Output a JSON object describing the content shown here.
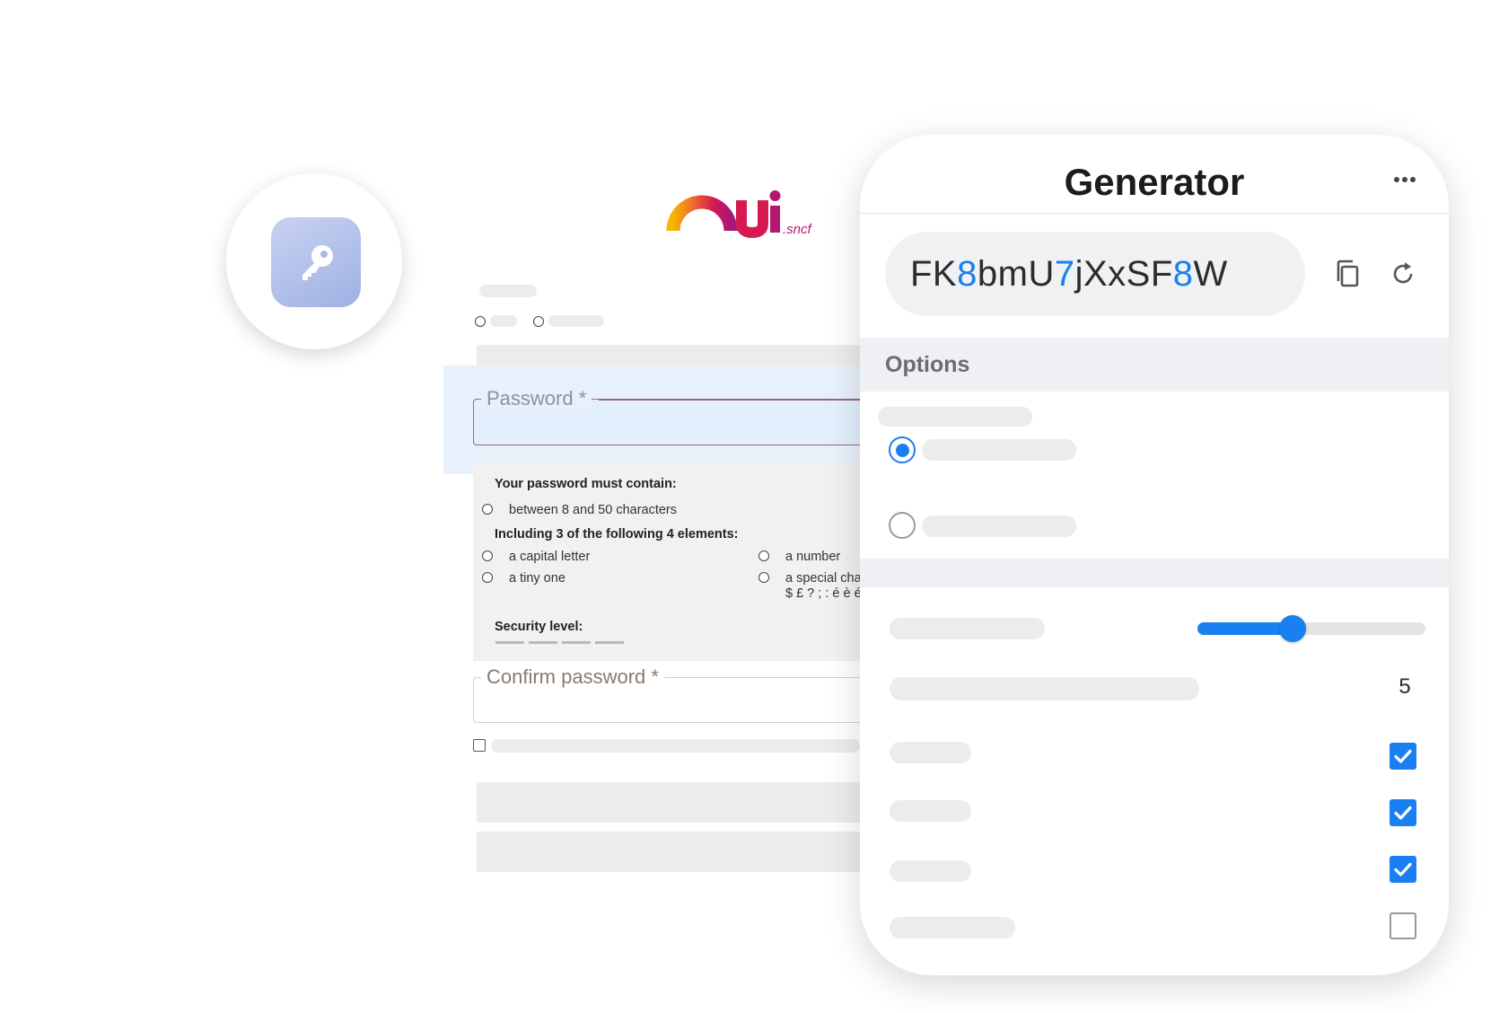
{
  "icons": {
    "app": "key-icon",
    "menu": "more-horizontal-icon",
    "copy": "copy-icon",
    "refresh": "refresh-icon"
  },
  "colors": {
    "accent": "#1a7ff0",
    "logo_gradient": [
      "#f7b500",
      "#ee6a2f",
      "#d6194f",
      "#a6177a"
    ]
  },
  "logo": {
    "main": "Oui",
    "suffix": ".sncf"
  },
  "form": {
    "password_label": "Password *",
    "rules_title": "Your password must contain:",
    "rule_length": "between 8 and 50 characters",
    "rules_subtitle": "Including 3 of the following 4 elements:",
    "rule_capital": "a capital letter",
    "rule_number": "a number",
    "rule_tiny": "a tiny one",
    "rule_special": "a special cha",
    "rule_special_chars": "$ £ ? ; : é è é",
    "security_level": "Security level:",
    "confirm_label": "Confirm password *"
  },
  "generator": {
    "title": "Generator",
    "password_parts": [
      {
        "text": "FK",
        "digit": false
      },
      {
        "text": "8",
        "digit": true
      },
      {
        "text": "bmU",
        "digit": false
      },
      {
        "text": "7",
        "digit": true
      },
      {
        "text": "jXxSF",
        "digit": false
      },
      {
        "text": "8",
        "digit": true
      },
      {
        "text": "W",
        "digit": false
      }
    ],
    "options_label": "Options",
    "selected_radio": 0,
    "length_slider_fraction": 0.36,
    "count_value": "5",
    "checkboxes": [
      true,
      true,
      true,
      false
    ]
  }
}
